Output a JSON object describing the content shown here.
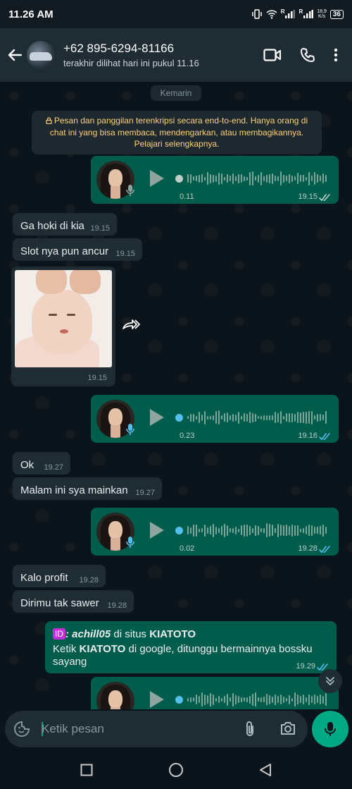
{
  "status_bar": {
    "time": "11.26 AM",
    "signal_labels": [
      "R",
      "R"
    ],
    "speed_value": "18,9",
    "speed_unit": "K/s",
    "battery": "36"
  },
  "header": {
    "contact_name": "+62 895-6294-81166",
    "last_seen": "terakhir dilihat hari ini pukul 11.16",
    "icons": [
      "back-arrow-icon",
      "video-call-icon",
      "phone-icon",
      "more-vert-icon"
    ]
  },
  "chat": {
    "date_divider": "Kemarin",
    "encryption_notice": "Pesan dan panggilan terenkripsi secara end-to-end. Hanya orang di chat ini yang bisa membaca, mendengarkan, atau membagikannya. Pelajari selengkapnya.",
    "voice_notes": [
      {
        "duration": "0.11",
        "time": "19.15",
        "status": "read-grey",
        "progress": 0.0
      },
      {
        "duration": "0.23",
        "time": "19.16",
        "status": "read-blue",
        "progress": 0.0
      },
      {
        "duration": "0.02",
        "time": "19.28",
        "status": "read-blue",
        "progress": 0.0
      },
      {
        "duration": "",
        "time": "",
        "status": "",
        "progress": 0.0
      }
    ],
    "incoming": [
      {
        "text": "Ga hoki di kia",
        "time": "19.15"
      },
      {
        "text": "Slot nya pun ancur",
        "time": "19.15"
      },
      {
        "text": "Ok",
        "time": "19.27"
      },
      {
        "text": "Malam ini sya mainkan",
        "time": "19.27"
      },
      {
        "text": "Kalo profit",
        "time": "19.28"
      },
      {
        "text": "Dirimu tak sawer",
        "time": "19.28"
      }
    ],
    "image_message": {
      "time": "19.15",
      "description_icon": "forward-icon"
    },
    "outgoing_text": {
      "badge": "ID",
      "handle": ": achill05",
      "middle": " di situs ",
      "brand": "KIATOTO",
      "line2_prefix": "Ketik ",
      "line2_brand": "KIATOTO",
      "line2_rest": " di google, ditunggu bermainnya bossku sayang",
      "time": "19.29",
      "status": "read-blue"
    }
  },
  "composer": {
    "placeholder": "Ketik pesan",
    "icons": [
      "emoji-sticker-icon",
      "attach-icon",
      "camera-icon",
      "mic-icon"
    ]
  },
  "colors": {
    "background": "#0b141a",
    "header": "#1f2c34",
    "incoming_bubble": "#202c33",
    "outgoing_bubble": "#005c4b",
    "accent": "#00a884",
    "read_tick": "#53bdeb",
    "encryption_text": "#ffd279"
  }
}
